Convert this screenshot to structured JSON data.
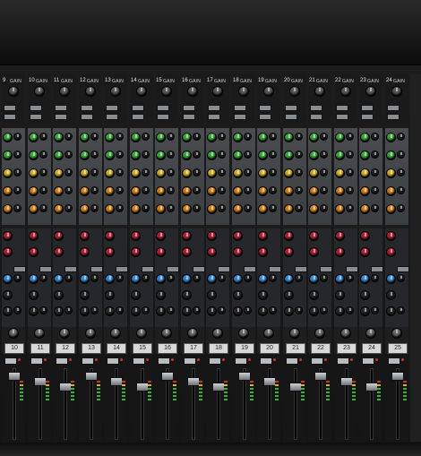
{
  "mixer": {
    "channels": [
      {
        "number": "9",
        "gain_label": "GAIN",
        "strip_label": "10"
      },
      {
        "number": "10",
        "gain_label": "GAIN",
        "strip_label": "11"
      },
      {
        "number": "11",
        "gain_label": "GAIN",
        "strip_label": "12"
      },
      {
        "number": "12",
        "gain_label": "GAIN",
        "strip_label": "13"
      },
      {
        "number": "13",
        "gain_label": "GAIN",
        "strip_label": "14"
      },
      {
        "number": "14",
        "gain_label": "GAIN",
        "strip_label": "15"
      },
      {
        "number": "15",
        "gain_label": "GAIN",
        "strip_label": "16"
      },
      {
        "number": "16",
        "gain_label": "GAIN",
        "strip_label": "17"
      },
      {
        "number": "17",
        "gain_label": "GAIN",
        "strip_label": "18"
      },
      {
        "number": "18",
        "gain_label": "GAIN",
        "strip_label": "19"
      },
      {
        "number": "19",
        "gain_label": "GAIN",
        "strip_label": "20"
      },
      {
        "number": "20",
        "gain_label": "GAIN",
        "strip_label": "21"
      },
      {
        "number": "21",
        "gain_label": "GAIN",
        "strip_label": "22"
      },
      {
        "number": "22",
        "gain_label": "GAIN",
        "strip_label": "23"
      },
      {
        "number": "23",
        "gain_label": "GAIN",
        "strip_label": "24"
      },
      {
        "number": "24",
        "gain_label": "GAIN",
        "strip_label": "25"
      }
    ],
    "extra_channel_number": "25",
    "extra_channel_gain": "GAIN",
    "colors": {
      "eq_green": "#3fae3f",
      "eq_yellow": "#d8b22a",
      "eq_orange": "#d9861f",
      "aux_red": "#b2253a",
      "aux_blue": "#3b8fd6",
      "knob_dark": "#2b2b2b",
      "panel_grey": "#474a4d"
    },
    "icons": [
      "rotary-knob-icon",
      "fader-icon",
      "led-icon"
    ]
  }
}
